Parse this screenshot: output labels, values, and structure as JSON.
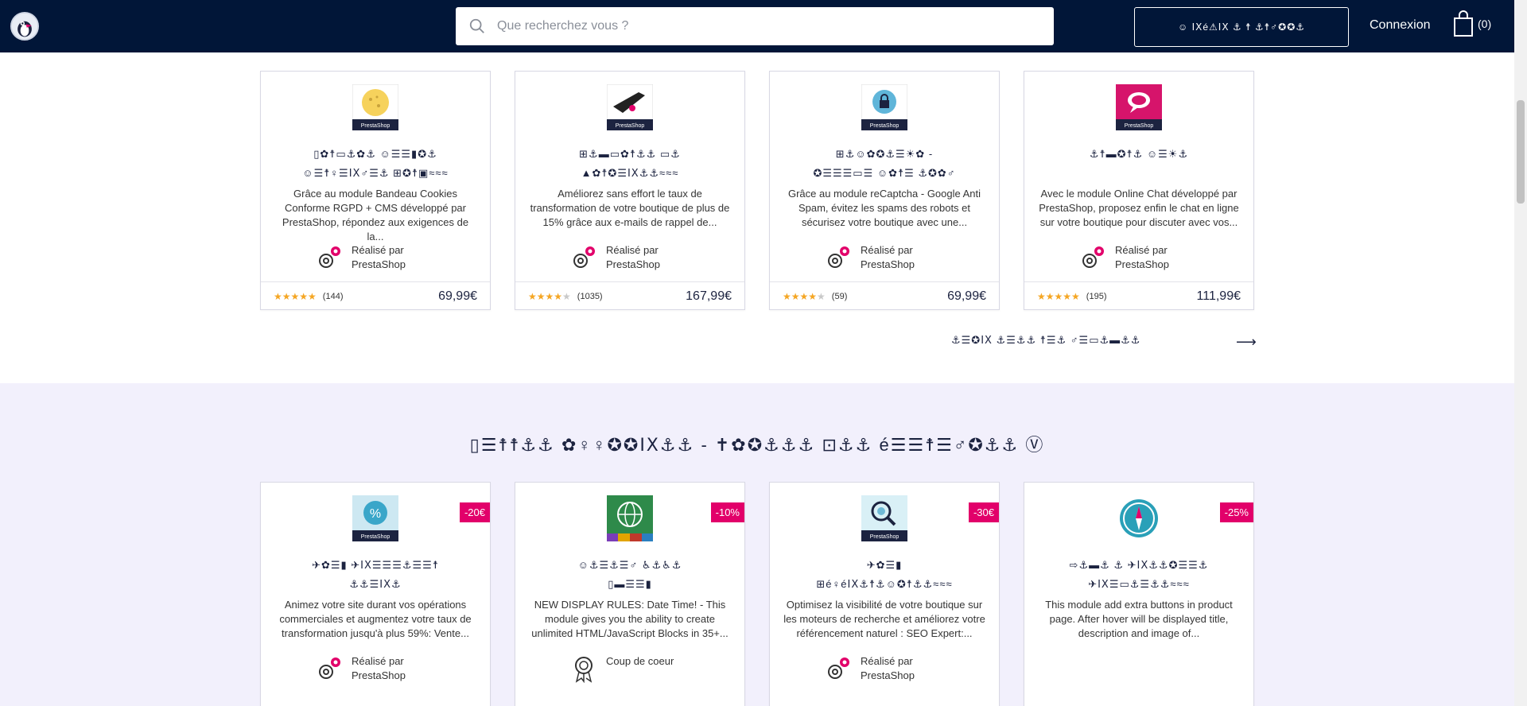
{
  "header": {
    "search_placeholder": "Que recherchez vous ?",
    "cta_label": "☺ ⅠⅩé⚠ⅠⅩ   ⚓ ☨   ⚓☨♂✪✪⚓",
    "login_label": "Connexion",
    "cart_count": "(0)"
  },
  "section1": {
    "cards": [
      {
        "name": "▯✿☨▭⚓✿⚓  ☺☰☰▮✪⚓\n☺☰☨♀☰ⅠⅩ♂☰⚓  ⊞✪☨▣≈≈≈",
        "description": "Grâce au module Bandeau Cookies Conforme RGPD + CMS développé par PrestaShop, répondez aux exigences de la...",
        "maker": "Réalisé par PrestaShop",
        "stars": 5,
        "reviews": "(144)",
        "price": "69,99€",
        "thumb_color": "#f6d25c"
      },
      {
        "name": "⊞⚓▬▭✿☨⚓⚓  ▭⚓\n▲✿☨✪☰ⅠⅩ⚓⚓≈≈≈",
        "description": "Améliorez sans effort le taux de transformation de votre boutique de plus de 15% grâce aux e-mails de rappel de...",
        "maker": "Réalisé par PrestaShop",
        "stars": 4,
        "reviews": "(1035)",
        "price": "167,99€",
        "thumb_color": "#222222"
      },
      {
        "name": "⊞⚓☺✿✪⚓☰☀✿  -\n✪☰☰☰▭☰  ☺✿☨☰  ⚓✪✿♂",
        "description": "Grâce au module reCaptcha - Google Anti Spam, évitez les spams des robots et sécurisez votre boutique avec une...",
        "maker": "Réalisé par PrestaShop",
        "stars": 4,
        "reviews": "(59)",
        "price": "69,99€",
        "thumb_color": "#5fb5d9"
      },
      {
        "name": "⚓☨▬✪☨⚓  ☺☰☀⚓",
        "description": "Avec le module Online Chat développé par PrestaShop, proposez enfin le chat en ligne sur votre boutique pour discuter avec vos...",
        "maker": "Réalisé par PrestaShop",
        "stars": 5,
        "reviews": "(195)",
        "price": "111,99€",
        "thumb_color": "#d6146b"
      }
    ],
    "see_all": "⚓☰✪ⅠⅩ  ⚓☰⚓⚓  ☨☰⚓  ♂☰▭⚓▬⚓⚓",
    "arrow": "⟶"
  },
  "section2": {
    "title": "▯☰☨☨⚓⚓  ✿♀♀✪✪ⅠⅩ⚓⚓  -  ✝✿✪⚓⚓⚓  ⊡⚓⚓  é☰☰☨☰♂✪⚓⚓  Ⓥ",
    "cards": [
      {
        "name": "✈✿☰▮  ✈ⅠⅩ☰☰☰⚓☰☰☨\n⚓⚓☰ⅠⅩ⚓",
        "description": "Animez votre site durant vos opérations commerciales et augmentez votre taux de transformation jusqu'à plus 59%: Vente...",
        "maker": "Réalisé par PrestaShop",
        "badge": "-20€",
        "thumb_color": "#3aa6c9",
        "maker_icon": "gear"
      },
      {
        "name": "☺⚓☰⚓☰♂  ♿⚓♿⚓\n▯▬☰☰▮",
        "description": "NEW DISPLAY RULES: Date Time! - This module gives you the ability to create unlimited HTML/JavaScript Blocks in 35+...",
        "maker": "Coup de coeur",
        "badge": "-10%",
        "thumb_color": "#2e8a4a",
        "maker_icon": "award"
      },
      {
        "name": "✈✿☰▮\n⊞é♀éⅠⅩ⚓☨⚓☺✪☨⚓⚓≈≈≈",
        "description": "Optimisez la visibilité de votre boutique sur les moteurs de recherche et améliorez votre référencement naturel : SEO Expert:...",
        "maker": "Réalisé par PrestaShop",
        "badge": "-30€",
        "thumb_color": "#6fb9d6",
        "maker_icon": "gear"
      },
      {
        "name": "⇨⚓▬⚓  ⚓  ✈ⅠⅩ⚓⚓✪☰☰⚓\n✈ⅠⅩ☰▭⚓☰⚓⚓≈≈≈",
        "description": "This module add extra buttons in product page. After hover will be displayed title, description and image of...",
        "maker": "",
        "badge": "-25%",
        "thumb_color": "#2aa0b8",
        "maker_icon": "none"
      }
    ]
  }
}
